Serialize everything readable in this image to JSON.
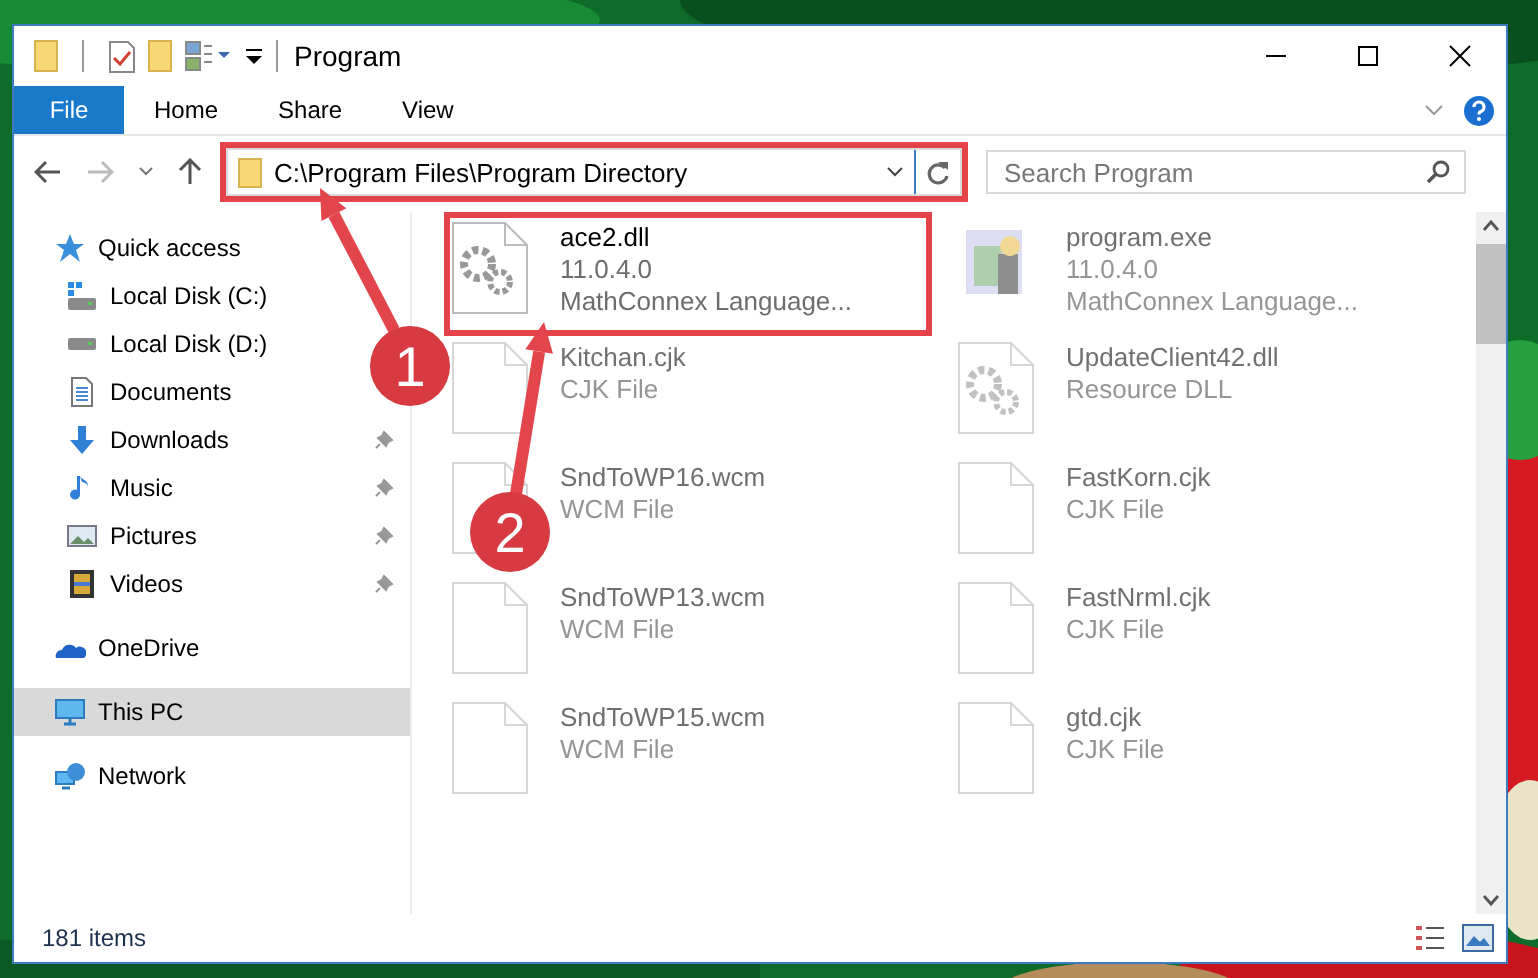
{
  "window": {
    "title": "Program"
  },
  "ribbon": {
    "tabs": [
      {
        "label": "File",
        "kind": "file",
        "selected": false
      },
      {
        "label": "Home",
        "kind": "tab",
        "selected": false
      },
      {
        "label": "Share",
        "kind": "tab",
        "selected": false
      },
      {
        "label": "View",
        "kind": "tab",
        "selected": false
      }
    ]
  },
  "address_bar": {
    "path": "C:\\Program Files\\Program Directory",
    "highlighted": true
  },
  "search": {
    "placeholder": "Search Program"
  },
  "navigation": [
    {
      "label": "Quick access",
      "kind": "star",
      "selected": false,
      "children": [
        {
          "label": "Local Disk (C:)",
          "kind": "system-drive",
          "pinned": false,
          "selected": false
        },
        {
          "label": "Local Disk (D:)",
          "kind": "drive",
          "pinned": false,
          "selected": false
        },
        {
          "label": "Documents",
          "kind": "documents",
          "pinned": false,
          "selected": false
        },
        {
          "label": "Downloads",
          "kind": "downloads",
          "pinned": true,
          "selected": false
        },
        {
          "label": "Music",
          "kind": "music",
          "pinned": true,
          "selected": false
        },
        {
          "label": "Pictures",
          "kind": "pictures",
          "pinned": true,
          "selected": false
        },
        {
          "label": "Videos",
          "kind": "videos",
          "pinned": true,
          "selected": false
        }
      ]
    },
    {
      "label": "OneDrive",
      "kind": "cloud",
      "selected": false
    },
    {
      "label": "This PC",
      "kind": "pc",
      "selected": true
    },
    {
      "label": "Network",
      "kind": "network",
      "selected": false
    }
  ],
  "files": [
    {
      "name": "ace2.dll",
      "details": [
        "11.0.4.0",
        "MathConnex Language..."
      ],
      "kind": "gear",
      "blurred": false,
      "highlighted": true
    },
    {
      "name": "program.exe",
      "details": [
        "11.0.4.0",
        "MathConnex Language..."
      ],
      "kind": "exe",
      "blurred": true,
      "highlighted": false
    },
    {
      "name": "Kitchan.cjk",
      "details": [
        "CJK File"
      ],
      "kind": "blank",
      "blurred": true,
      "highlighted": false
    },
    {
      "name": "UpdateClient42.dll",
      "details": [
        "Resource DLL"
      ],
      "kind": "gear",
      "blurred": true,
      "highlighted": false
    },
    {
      "name": "SndToWP16.wcm",
      "details": [
        "WCM File"
      ],
      "kind": "blank",
      "blurred": true,
      "highlighted": false
    },
    {
      "name": "FastKorn.cjk",
      "details": [
        "CJK File"
      ],
      "kind": "blank",
      "blurred": true,
      "highlighted": false
    },
    {
      "name": "SndToWP13.wcm",
      "details": [
        "WCM File"
      ],
      "kind": "blank",
      "blurred": true,
      "highlighted": false
    },
    {
      "name": "FastNrml.cjk",
      "details": [
        "CJK File"
      ],
      "kind": "blank",
      "blurred": true,
      "highlighted": false
    },
    {
      "name": "SndToWP15.wcm",
      "details": [
        "WCM File"
      ],
      "kind": "blank",
      "blurred": true,
      "highlighted": false
    },
    {
      "name": "gtd.cjk",
      "details": [
        "CJK File"
      ],
      "kind": "blank",
      "blurred": true,
      "highlighted": false
    }
  ],
  "status_bar": {
    "item_count": "181 items"
  },
  "callouts": [
    {
      "number": "1"
    },
    {
      "number": "2"
    }
  ]
}
